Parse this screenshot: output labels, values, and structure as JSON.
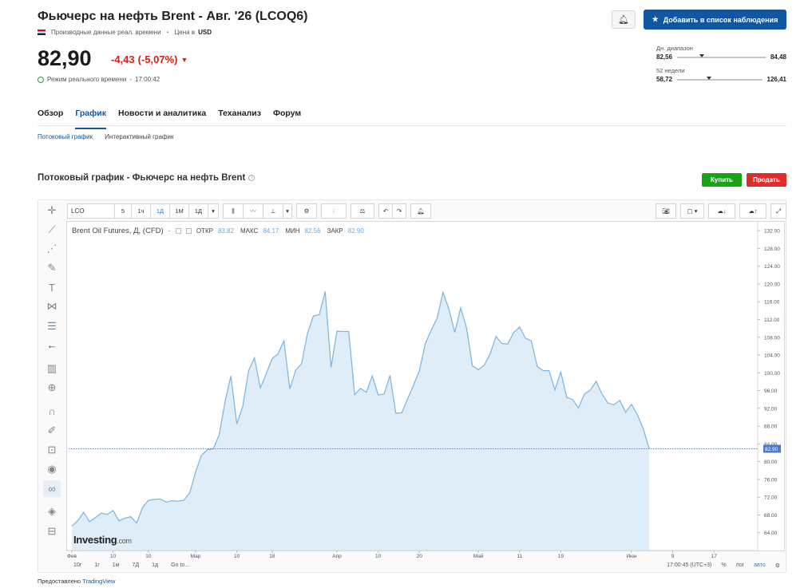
{
  "header": {
    "title": "Фьючерс на нефть Brent - Авг. '26 (LCOQ6)",
    "data_source": "Производные данные реал. времени",
    "currency_label": "Цена в",
    "currency": "USD",
    "price": "82,90",
    "change": "-4,43",
    "change_pct": "(-5,07%)",
    "realtime_label": "Режим реального времени",
    "realtime_time": "17:00:42",
    "watchlist_button": "Добавить в список наблюдения",
    "day_range": {
      "label": "Дн. диапазон",
      "low": "82,56",
      "high": "84,48",
      "position": 0.25
    },
    "week52_range": {
      "label": "52 недели",
      "low": "58,72",
      "high": "126,41",
      "position": 0.35
    }
  },
  "nav": {
    "tabs": [
      {
        "label": "Обзор",
        "active": false
      },
      {
        "label": "График",
        "active": true
      },
      {
        "label": "Новости и аналитика",
        "active": false
      },
      {
        "label": "Теханализ",
        "active": false
      },
      {
        "label": "Форум",
        "active": false
      }
    ],
    "subtabs": [
      {
        "label": "Потоковый график",
        "active": true
      },
      {
        "label": "Интерактивный график",
        "active": false
      }
    ]
  },
  "section": {
    "title": "Потоковый график - Фьючерс на нефть Brent",
    "buy": "Купить",
    "sell": "Продать"
  },
  "toolbar": {
    "symbol": "LCO",
    "intervals": [
      "5",
      "1ч",
      "1Д",
      "1М",
      "1Д"
    ],
    "active_interval": "1Д"
  },
  "legend": {
    "name": "Brent Oil Futures, Д, (CFD)",
    "open_label": "ОТКР",
    "open": "83.82",
    "high_label": "МАКС",
    "high": "84.17",
    "low_label": "МИН",
    "low": "82.56",
    "close_label": "ЗАКР",
    "close": "82.90"
  },
  "logo": {
    "brand": "Investing",
    "suffix": ".com"
  },
  "bottom_bar": {
    "periods": [
      "10г",
      "1г",
      "1м",
      "7Д",
      "1д",
      "Go to..."
    ],
    "time": "17:00:45 (UTC+3)",
    "percent": "%",
    "log": "лог",
    "auto": "авто"
  },
  "footer": {
    "prefix": "Предоставлено",
    "provider": "TradingView"
  },
  "colors": {
    "accent": "#1256a0",
    "negative": "#d91e18",
    "buy": "#17a517",
    "sell": "#e02b2b",
    "line": "#7ab4e0",
    "fill": "#deedf8"
  },
  "chart_data": {
    "type": "area",
    "title": "Brent Oil Futures, Д, (CFD)",
    "xlabel": "",
    "ylabel": "",
    "ylim": [
      60,
      134
    ],
    "y_ticks": [
      "132.00",
      "128.00",
      "124.00",
      "120.00",
      "116.00",
      "112.00",
      "108.00",
      "104.00",
      "100.00",
      "96.00",
      "92.00",
      "88.00",
      "84.00",
      "80.00",
      "76.00",
      "72.00",
      "68.00",
      "64.00"
    ],
    "x_ticks": [
      {
        "label": "Фев",
        "i": 0
      },
      {
        "label": "10",
        "i": 7
      },
      {
        "label": "10",
        "i": 13
      },
      {
        "label": "Мар",
        "i": 21
      },
      {
        "label": "10",
        "i": 28
      },
      {
        "label": "18",
        "i": 34
      },
      {
        "label": "Апр",
        "i": 45
      },
      {
        "label": "10",
        "i": 52
      },
      {
        "label": "20",
        "i": 59
      },
      {
        "label": "Май",
        "i": 69
      },
      {
        "label": "11",
        "i": 76
      },
      {
        "label": "19",
        "i": 83
      },
      {
        "label": "Июн",
        "i": 95
      },
      {
        "label": "9",
        "i": 102
      },
      {
        "label": "17",
        "i": 109
      }
    ],
    "x_total": 112,
    "values": [
      65.5,
      66.7,
      68.6,
      66.5,
      67.4,
      68.4,
      68.1,
      69.0,
      66.7,
      67.3,
      67.6,
      66.2,
      69.7,
      71.3,
      71.5,
      71.6,
      70.9,
      71.2,
      71.1,
      71.3,
      73.0,
      77.7,
      81.4,
      82.7,
      82.9,
      86.0,
      93.5,
      99.3,
      88.5,
      92.4,
      100.5,
      103.4,
      96.6,
      99.8,
      103.2,
      104.3,
      107.2,
      96.4,
      100.6,
      102.1,
      108.9,
      112.8,
      113.1,
      118.3,
      101.2,
      109.4,
      109.3,
      109.3,
      95.1,
      96.5,
      95.6,
      99.3,
      95.0,
      95.2,
      99.4,
      90.9,
      91.0,
      94.2,
      97.2,
      100.5,
      106.6,
      109.6,
      112.3,
      118.1,
      114.4,
      109.1,
      114.6,
      110.1,
      101.6,
      100.7,
      101.7,
      104.3,
      108.2,
      106.6,
      106.5,
      109.1,
      110.3,
      107.8,
      107.2,
      101.4,
      100.5,
      100.5,
      96.2,
      100.2,
      94.5,
      94.0,
      92.1,
      95.2,
      96.1,
      98.1,
      95.2,
      93.2,
      92.8,
      93.8,
      91.1,
      92.9,
      90.6,
      87.4,
      82.9
    ],
    "last_value": 82.9,
    "grid": false
  }
}
